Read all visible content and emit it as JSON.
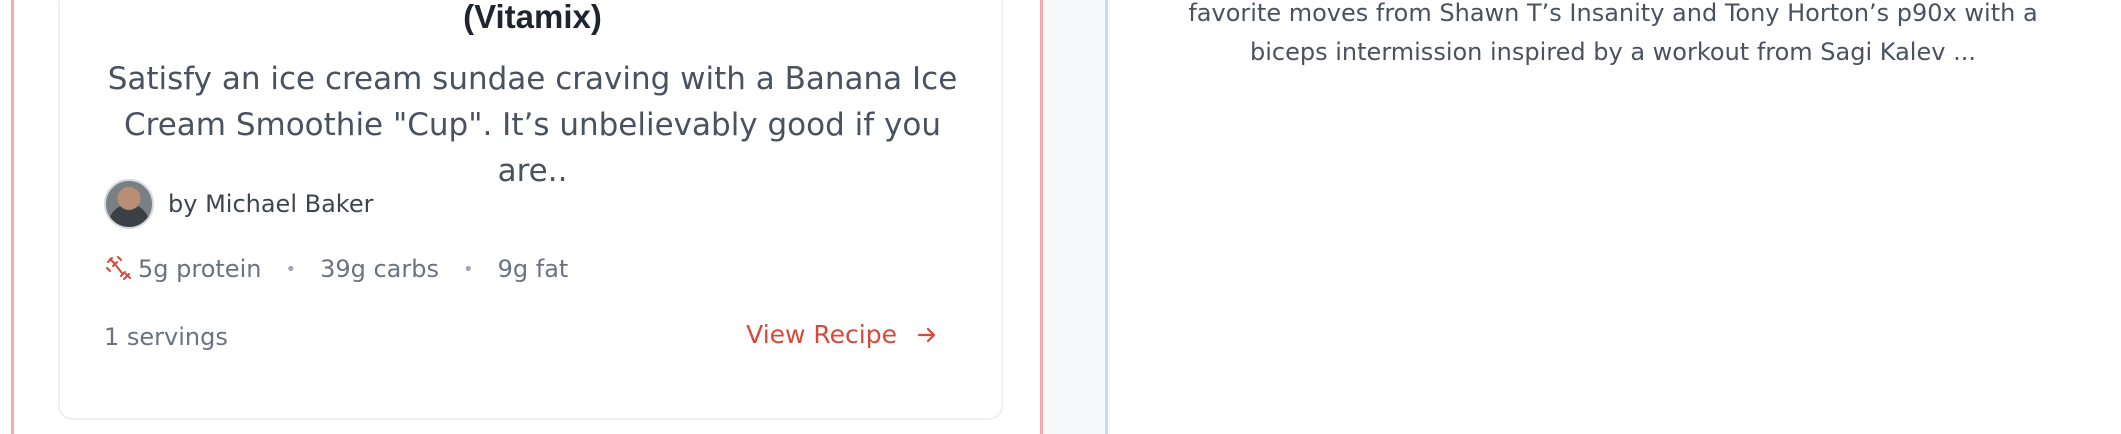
{
  "left_card": {
    "title": "(Vitamix)",
    "description": "Satisfy an ice cream sundae craving with a Banana Ice Cream Smoothie \"Cup\". It’s unbelievably good if you are..",
    "author": "by Michael Baker",
    "macros": {
      "icon": "dumbbell-icon",
      "protein": "5g protein",
      "separator": "•",
      "carbs": "39g carbs",
      "fat": "9g fat"
    },
    "servings": "1 servings",
    "view_recipe": "View Recipe",
    "accent_color": "#d9483b"
  },
  "right_card": {
    "description": "favorite moves from Shawn T’s Insanity and Tony Horton’s p90x with a biceps intermission inspired by a workout from Sagi Kalev ..."
  },
  "colors": {
    "left_border": "#f5aab1",
    "right_border": "#c9dcf5"
  }
}
